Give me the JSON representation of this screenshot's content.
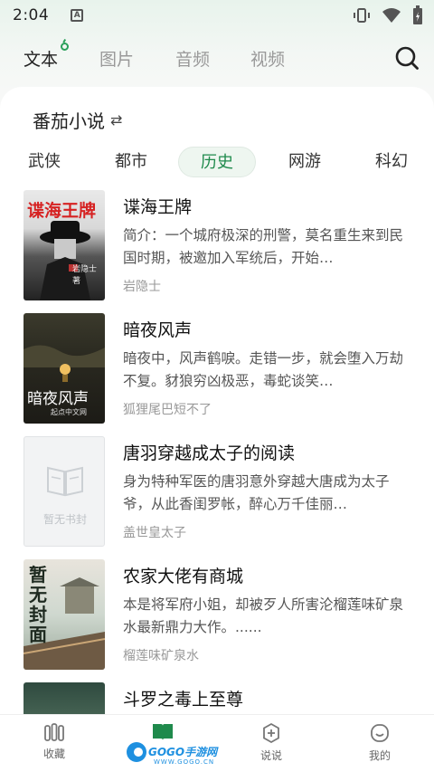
{
  "status": {
    "time": "2:04",
    "notif_icon": "A"
  },
  "top_tabs": [
    {
      "label": "文本",
      "active": true
    },
    {
      "label": "图片",
      "active": false
    },
    {
      "label": "音频",
      "active": false
    },
    {
      "label": "视频",
      "active": false
    }
  ],
  "source": {
    "label": "番茄小说",
    "swap": "⇄"
  },
  "categories": [
    "武侠",
    "都市",
    "历史",
    "网游",
    "科幻"
  ],
  "active_category": "历史",
  "books": [
    {
      "title": "谍海王牌",
      "desc": "简介：一个城府极深的刑警，莫名重生来到民国时期，被邀加入军统后，开始…",
      "author": "岩隐士",
      "cover_text": "谍海王牌",
      "cover_sub": "岩隐士 著"
    },
    {
      "title": "暗夜风声",
      "desc": "暗夜中，风声鹤唳。走错一步，就会堕入万劫不复。豺狼穷凶极恶，毒蛇谈笑…",
      "author": "狐狸尾巴短不了",
      "cover_text": "暗夜风声",
      "cover_sub": "起点中文网"
    },
    {
      "title": "唐羽穿越成太子的阅读",
      "desc": "身为特种军医的唐羽意外穿越大唐成为太子爷，从此香闺罗帐，醉心万千佳丽…",
      "author": "盖世皇太子",
      "cover_text": "暂无书封"
    },
    {
      "title": "农家大佬有商城",
      "desc": "本是将军府小姐，却被歹人所害沦榴莲味矿泉水最新鼎力大作。......",
      "author": "榴莲味矿泉水",
      "cover_text": "暂无封面"
    },
    {
      "title": "斗罗之毒上至尊",
      "desc": "",
      "author": ""
    }
  ],
  "bottom_nav": [
    {
      "label": "收藏"
    },
    {
      "label": ""
    },
    {
      "label": "说说"
    },
    {
      "label": "我的"
    }
  ],
  "watermark": {
    "text": "GOGO手游网",
    "sub": "WWW.GOGO.CN"
  }
}
